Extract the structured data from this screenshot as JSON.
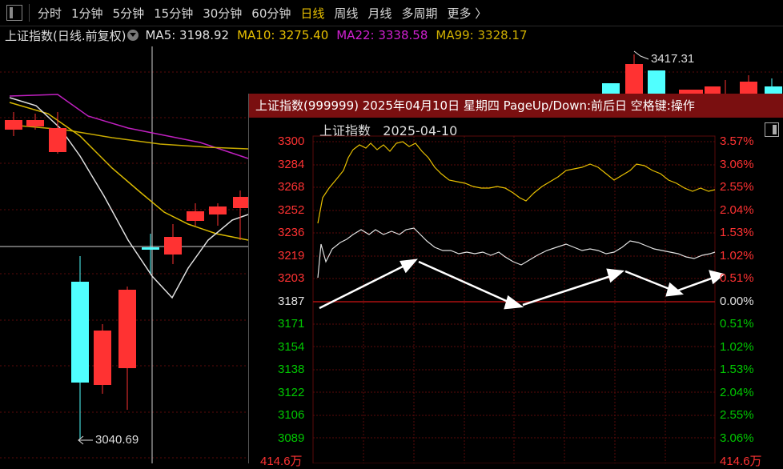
{
  "toolbar": {
    "items": [
      "分时",
      "1分钟",
      "5分钟",
      "15分钟",
      "30分钟",
      "60分钟",
      "日线",
      "周线",
      "月线",
      "多周期",
      "更多 〉"
    ],
    "active": "日线"
  },
  "ma_bar": {
    "name": "上证指数(日线.前复权)",
    "ma5": "MA5: 3198.92",
    "ma10": "MA10: 3275.40",
    "ma22": "MA22: 3338.58",
    "ma99": "MA99: 3328.17",
    "colors": {
      "ma5": "#e0e0e0",
      "ma10": "#e8c000",
      "ma22": "#d020d0",
      "ma99": "#d0b000"
    }
  },
  "kline": {
    "high_label": "3417.31",
    "low_label": "3040.69"
  },
  "popup": {
    "title": "上证指数(999999) 2025年04月10日 星期四 PageUp/Down:前后日 空格键:操作",
    "subtitle_name": "上证指数",
    "subtitle_date": "2025-04-10",
    "left_ticks": [
      "3300",
      "3284",
      "3268",
      "3252",
      "3236",
      "3219",
      "3203",
      "3187",
      "3171",
      "3154",
      "3138",
      "3122",
      "3106",
      "3089"
    ],
    "right_ticks": [
      "3.57%",
      "3.06%",
      "2.55%",
      "2.04%",
      "1.53%",
      "1.02%",
      "0.51%",
      "0.00%",
      "0.51%",
      "1.02%",
      "1.53%",
      "2.04%",
      "2.55%",
      "3.06%"
    ],
    "volume_left": "414.6万",
    "volume_right": "414.6万",
    "colors": {
      "up": "#ff3232",
      "down": "#00c800",
      "base": "#e0e0e0",
      "price": "#e0e0e0",
      "avg": "#e8c000",
      "title_bg": "#7a0f10"
    }
  }
}
